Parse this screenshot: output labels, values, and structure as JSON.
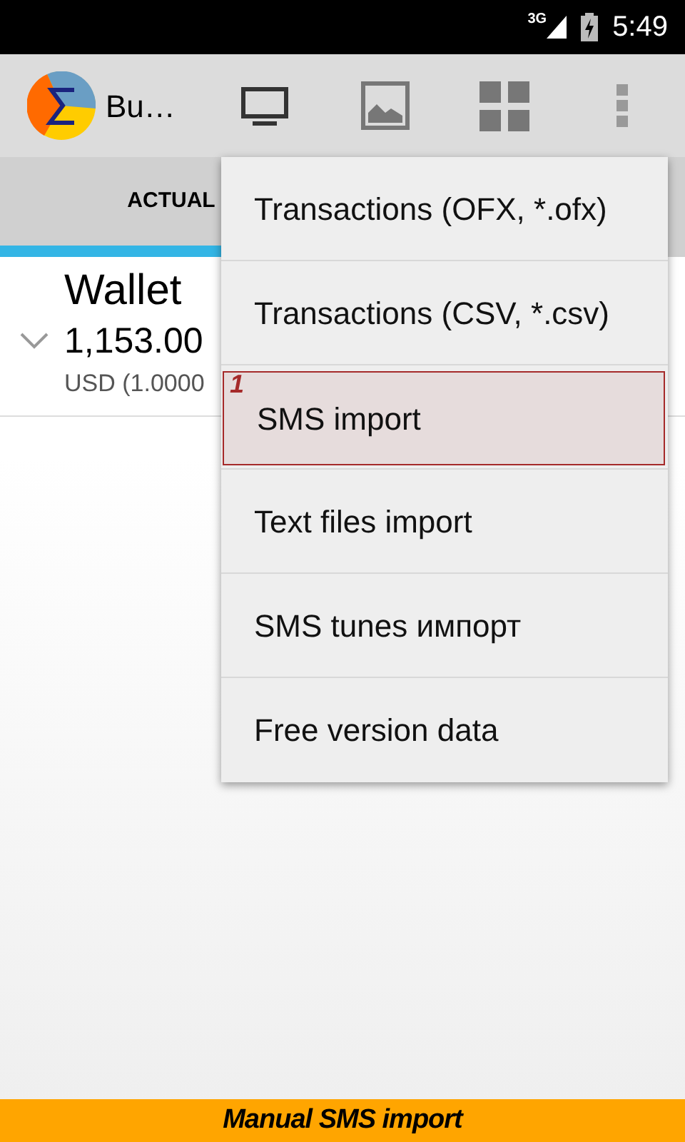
{
  "status_bar": {
    "network": "3G",
    "time": "5:49"
  },
  "action_bar": {
    "title": "Bu…"
  },
  "tabs": [
    {
      "label": "ACTUAL",
      "selected": true
    }
  ],
  "accounts": [
    {
      "name": "Wallet",
      "balance": "1,153.00",
      "currency": "USD (1.0000",
      "expanded": false
    }
  ],
  "menu": {
    "items": [
      {
        "label": "Transactions (OFX, *.ofx)",
        "highlighted": false
      },
      {
        "label": "Transactions (CSV, *.csv)",
        "highlighted": false
      },
      {
        "label": "SMS import",
        "highlighted": true,
        "marker": "1"
      },
      {
        "label": "Text files import",
        "highlighted": false
      },
      {
        "label": "SMS tunes импорт",
        "highlighted": false
      },
      {
        "label": "Free version data",
        "highlighted": false
      }
    ]
  },
  "banner": {
    "text": "Manual SMS import"
  }
}
